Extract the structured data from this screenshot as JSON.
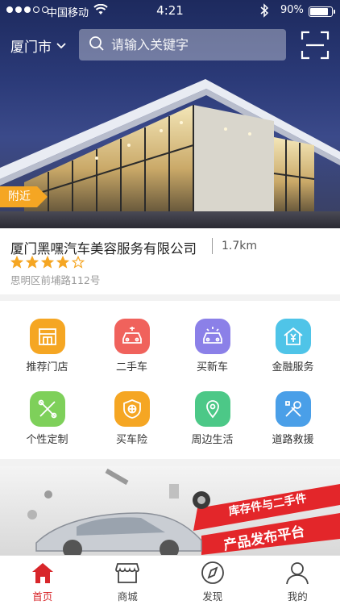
{
  "status_bar": {
    "carrier": "中国移动",
    "time": "4:21",
    "battery_percent": "90%",
    "battery_level": 0.9
  },
  "header": {
    "city": "厦门市",
    "search_placeholder": "请输入关键字"
  },
  "hero": {
    "tag": "附近"
  },
  "shop": {
    "name": "厦门黑嘿汽车美容服务有限公司",
    "distance": "1.7km",
    "rating": 4,
    "rating_max": 5,
    "address": "思明区前埔路112号"
  },
  "services": [
    {
      "label": "推荐门店",
      "icon": "store-icon",
      "color": "#f5a623"
    },
    {
      "label": "二手车",
      "icon": "used-car-icon",
      "color": "#f0625c"
    },
    {
      "label": "买新车",
      "icon": "new-car-icon",
      "color": "#8b80e8"
    },
    {
      "label": "金融服务",
      "icon": "finance-icon",
      "color": "#4fc4e8"
    },
    {
      "label": "个性定制",
      "icon": "customize-icon",
      "color": "#7ed05a"
    },
    {
      "label": "买车险",
      "icon": "insurance-icon",
      "color": "#f5a623"
    },
    {
      "label": "周边生活",
      "icon": "location-pin-icon",
      "color": "#4cc887"
    },
    {
      "label": "道路救援",
      "icon": "rescue-tools-icon",
      "color": "#4a9fe8"
    }
  ],
  "banner": {
    "text": "库存件与二手件",
    "text2": "产品发布平台",
    "accent": "#e3262a"
  },
  "tabbar": {
    "active_color": "#d8262a",
    "items": [
      {
        "label": "首页",
        "icon": "home-icon",
        "active": true
      },
      {
        "label": "商城",
        "icon": "shop-icon",
        "active": false
      },
      {
        "label": "发现",
        "icon": "compass-icon",
        "active": false
      },
      {
        "label": "我的",
        "icon": "user-icon",
        "active": false
      }
    ]
  }
}
